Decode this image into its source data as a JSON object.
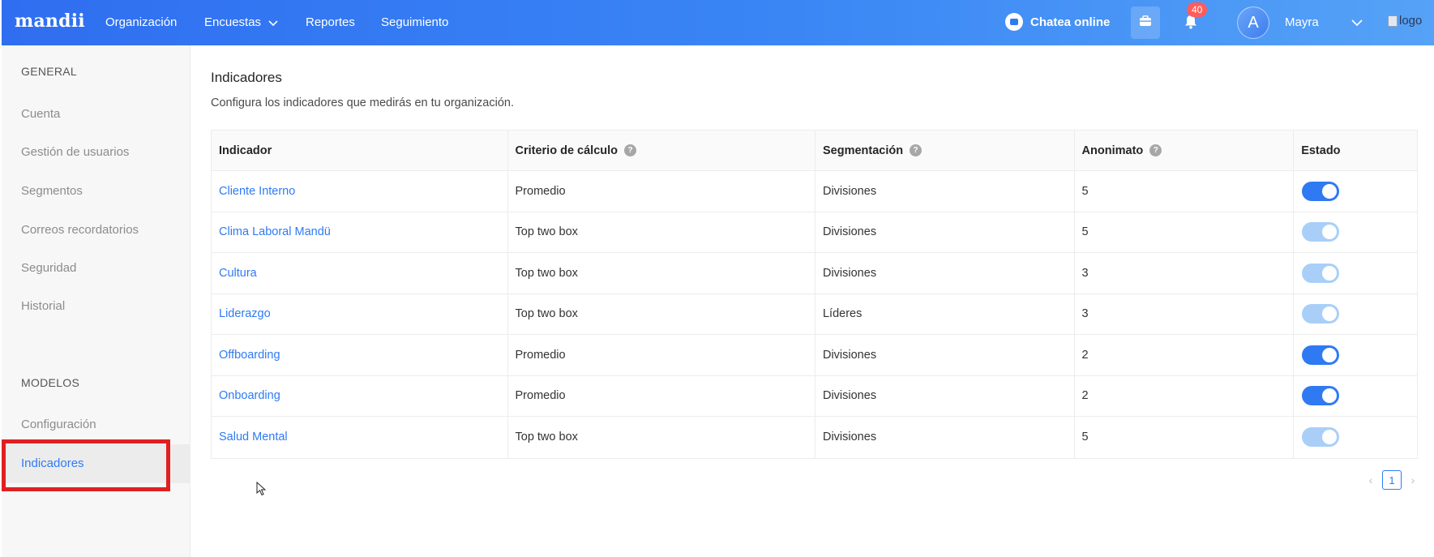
{
  "topbar": {
    "brand": "mandii",
    "nav": [
      {
        "label": "Organización"
      },
      {
        "label": "Encuestas"
      },
      {
        "label": "Reportes"
      },
      {
        "label": "Seguimiento"
      }
    ],
    "chat_label": "Chatea online",
    "notification_count": "40",
    "avatar_initial": "A",
    "user_name": "Mayra",
    "logo_alt": "logo"
  },
  "sidebar": {
    "general_title": "GENERAL",
    "general_items": [
      {
        "label": "Cuenta"
      },
      {
        "label": "Gestión de usuarios"
      },
      {
        "label": "Segmentos"
      },
      {
        "label": "Correos recordatorios"
      },
      {
        "label": "Seguridad"
      },
      {
        "label": "Historial"
      }
    ],
    "models_title": "MODELOS",
    "models_items": [
      {
        "label": "Configuración"
      },
      {
        "label": "Indicadores",
        "active": true
      }
    ]
  },
  "main": {
    "title": "Indicadores",
    "description": "Configura los indicadores que medirás en tu organización.",
    "columns": [
      "Indicador",
      "Criterio de cálculo",
      "Segmentación",
      "Anonimato",
      "Estado"
    ],
    "rows": [
      {
        "indicador": "Cliente Interno",
        "criterio": "Promedio",
        "segmentacion": "Divisiones",
        "anonimato": "5",
        "estado": "on"
      },
      {
        "indicador": "Clima Laboral Mandü",
        "criterio": "Top two box",
        "segmentacion": "Divisiones",
        "anonimato": "5",
        "estado": "on-disabled"
      },
      {
        "indicador": "Cultura",
        "criterio": "Top two box",
        "segmentacion": "Divisiones",
        "anonimato": "3",
        "estado": "on-disabled"
      },
      {
        "indicador": "Liderazgo",
        "criterio": "Top two box",
        "segmentacion": "Líderes",
        "anonimato": "3",
        "estado": "on-disabled"
      },
      {
        "indicador": "Offboarding",
        "criterio": "Promedio",
        "segmentacion": "Divisiones",
        "anonimato": "2",
        "estado": "on"
      },
      {
        "indicador": "Onboarding",
        "criterio": "Promedio",
        "segmentacion": "Divisiones",
        "anonimato": "2",
        "estado": "on"
      },
      {
        "indicador": "Salud Mental",
        "criterio": "Top two box",
        "segmentacion": "Divisiones",
        "anonimato": "5",
        "estado": "on-disabled"
      }
    ],
    "pagination": {
      "current": "1"
    }
  },
  "colors": {
    "accent": "#2f7af3",
    "toggle_disabled": "#a9cff8",
    "badge": "#ff5c5c",
    "highlight": "#e02020"
  }
}
